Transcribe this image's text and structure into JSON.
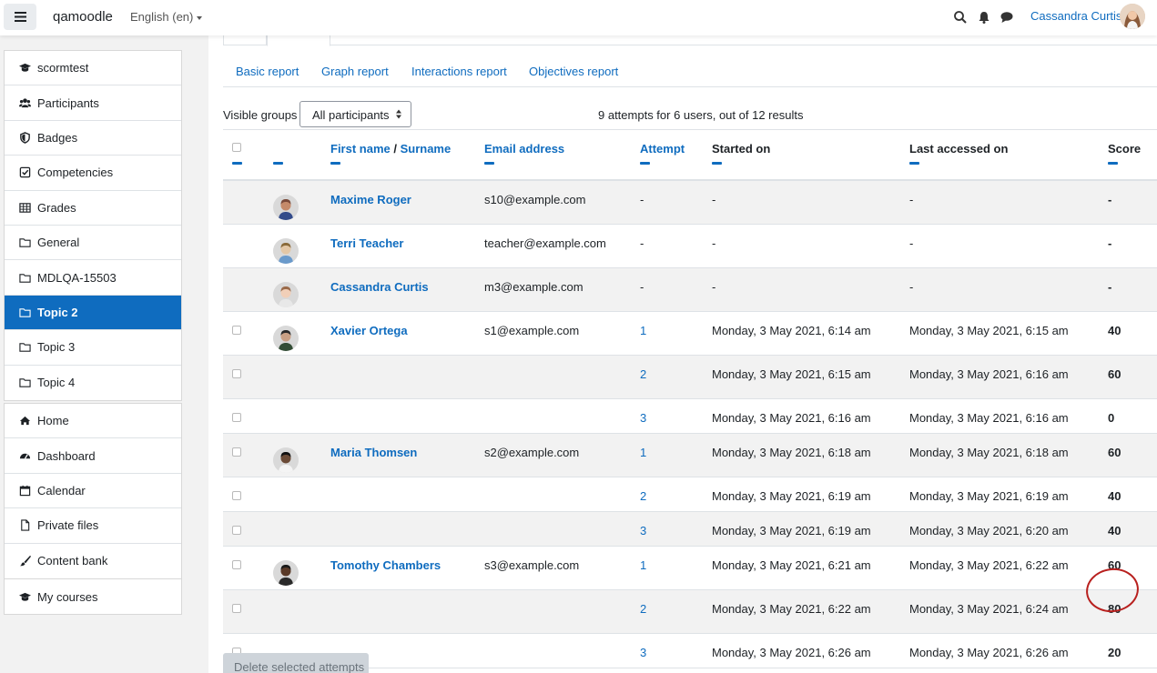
{
  "navbar": {
    "brand": "qamoodle",
    "language": "English (en)",
    "username": "Cassandra Curtis"
  },
  "drawer": {
    "course_items": [
      {
        "label": "scormtest",
        "icon": "graduation-cap-icon"
      },
      {
        "label": "Participants",
        "icon": "users-icon"
      },
      {
        "label": "Badges",
        "icon": "shield-icon"
      },
      {
        "label": "Competencies",
        "icon": "check-square-icon"
      },
      {
        "label": "Grades",
        "icon": "table-icon"
      },
      {
        "label": "General",
        "icon": "folder-icon"
      },
      {
        "label": "MDLQA-15503",
        "icon": "folder-icon"
      },
      {
        "label": "Topic 2",
        "icon": "folder-icon"
      },
      {
        "label": "Topic 3",
        "icon": "folder-icon"
      },
      {
        "label": "Topic 4",
        "icon": "folder-icon"
      }
    ],
    "site_items": [
      {
        "label": "Home",
        "icon": "home-icon"
      },
      {
        "label": "Dashboard",
        "icon": "dashboard-icon"
      },
      {
        "label": "Calendar",
        "icon": "calendar-icon"
      },
      {
        "label": "Private files",
        "icon": "file-icon"
      },
      {
        "label": "Content bank",
        "icon": "paintbrush-icon"
      }
    ],
    "mycourses": {
      "label": "My courses",
      "icon": "graduation-cap-icon"
    },
    "active": "Topic 2"
  },
  "report_tabs": [
    "Basic report",
    "Graph report",
    "Interactions report",
    "Objectives report"
  ],
  "groups": {
    "label": "Visible groups",
    "selected": "All participants"
  },
  "summary": "9 attempts for 6 users, out of 12 results",
  "table": {
    "headers": {
      "first_name": "First name",
      "separator": " / ",
      "surname": "Surname",
      "email": "Email address",
      "attempt": "Attempt",
      "started": "Started on",
      "last_accessed": "Last accessed on",
      "score": "Score"
    },
    "rows": [
      {
        "name": "Maxime Roger",
        "email": "s10@example.com",
        "attempt": "-",
        "started": "-",
        "last": "-",
        "score": "-"
      },
      {
        "name": "Terri Teacher",
        "email": "teacher@example.com",
        "attempt": "-",
        "started": "-",
        "last": "-",
        "score": "-"
      },
      {
        "name": "Cassandra Curtis",
        "email": "m3@example.com",
        "attempt": "-",
        "started": "-",
        "last": "-",
        "score": "-"
      },
      {
        "name": "Xavier Ortega",
        "email": "s1@example.com",
        "attempt": "1",
        "started": "Monday, 3 May 2021, 6:14 am",
        "last": "Monday, 3 May 2021, 6:15 am",
        "score": "40"
      },
      {
        "name": "",
        "email": "",
        "attempt": "2",
        "started": "Monday, 3 May 2021, 6:15 am",
        "last": "Monday, 3 May 2021, 6:16 am",
        "score": "60"
      },
      {
        "name": "",
        "email": "",
        "attempt": "3",
        "started": "Monday, 3 May 2021, 6:16 am",
        "last": "Monday, 3 May 2021, 6:16 am",
        "score": "0"
      },
      {
        "name": "Maria Thomsen",
        "email": "s2@example.com",
        "attempt": "1",
        "started": "Monday, 3 May 2021, 6:18 am",
        "last": "Monday, 3 May 2021, 6:18 am",
        "score": "60"
      },
      {
        "name": "",
        "email": "",
        "attempt": "2",
        "started": "Monday, 3 May 2021, 6:19 am",
        "last": "Monday, 3 May 2021, 6:19 am",
        "score": "40"
      },
      {
        "name": "",
        "email": "",
        "attempt": "3",
        "started": "Monday, 3 May 2021, 6:19 am",
        "last": "Monday, 3 May 2021, 6:20 am",
        "score": "40"
      },
      {
        "name": "Tomothy Chambers",
        "email": "s3@example.com",
        "attempt": "1",
        "started": "Monday, 3 May 2021, 6:21 am",
        "last": "Monday, 3 May 2021, 6:22 am",
        "score": "60"
      },
      {
        "name": "",
        "email": "",
        "attempt": "2",
        "started": "Monday, 3 May 2021, 6:22 am",
        "last": "Monday, 3 May 2021, 6:24 am",
        "score": "80"
      },
      {
        "name": "",
        "email": "",
        "attempt": "3",
        "started": "Monday, 3 May 2021, 6:26 am",
        "last": "Monday, 3 May 2021, 6:26 am",
        "score": "20"
      }
    ]
  },
  "delete_button": "Delete selected attempts",
  "colors": {
    "link": "#0f6cbf",
    "active_bg": "#0f6cbf",
    "annotation_circle": "#b8201e"
  }
}
